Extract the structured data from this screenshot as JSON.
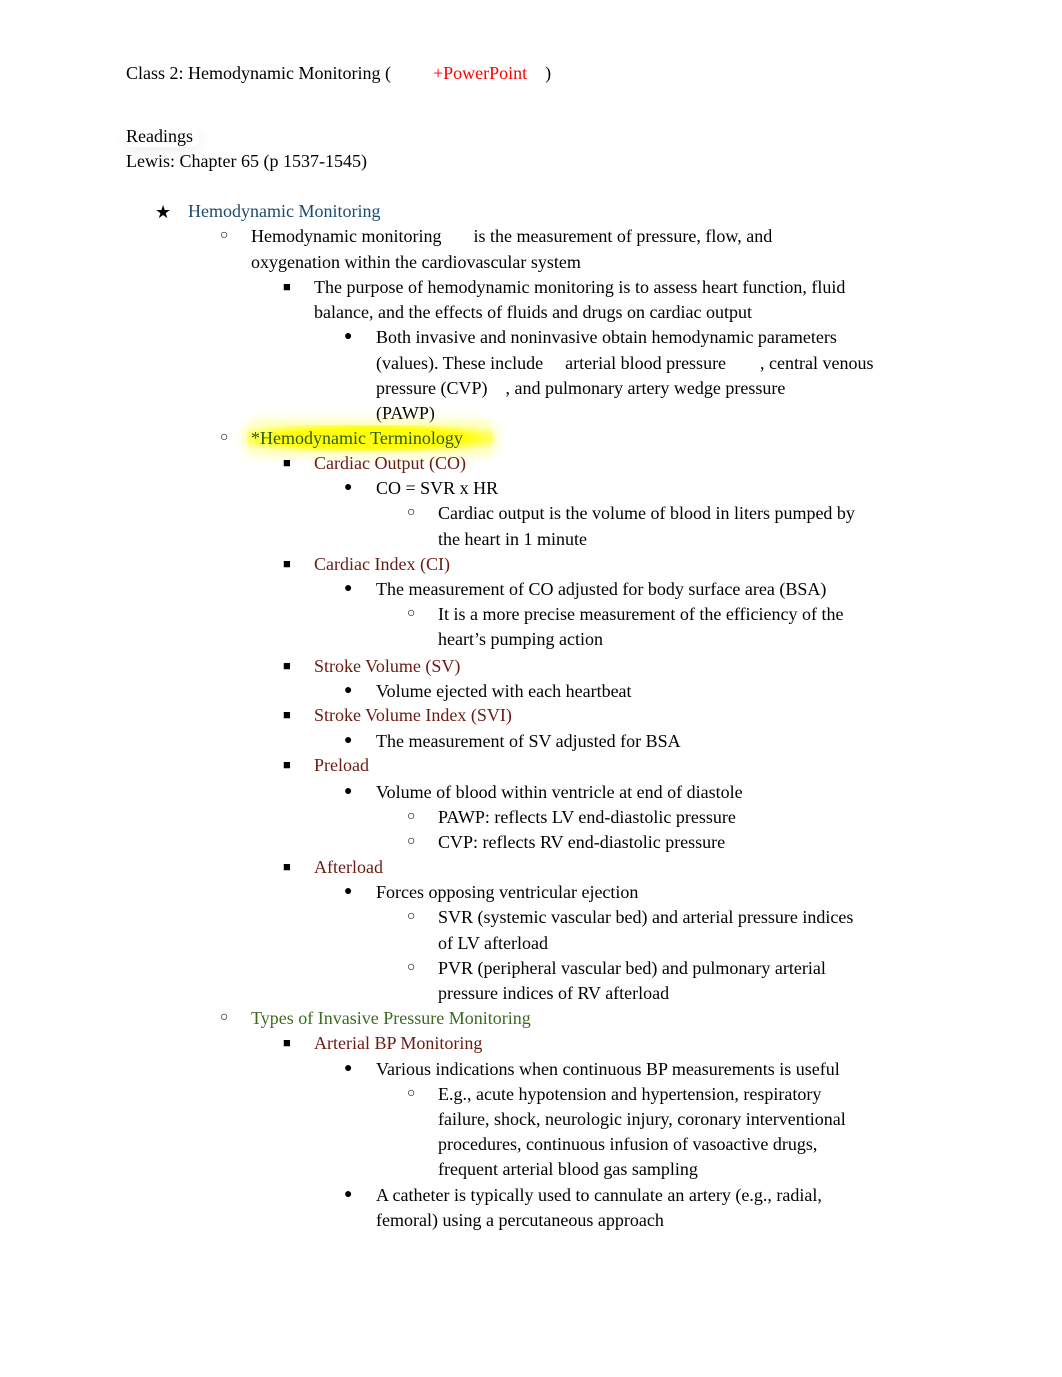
{
  "header": {
    "title_prefix": "Class 2: Hemodynamic Monitoring (",
    "title_link": "+PowerPoint",
    "title_suffix": ")"
  },
  "readings": {
    "label": "Readings",
    "reference": "Lewis: Chapter 65 (p 1537-1545)"
  },
  "outline": {
    "section_title": "Hemodynamic Monitoring",
    "definition": {
      "line1_a": "Hemodynamic monitoring",
      "line1_b": "is the measurement of pressure, flow, and",
      "line2": "oxygenation within the cardiovascular system"
    },
    "purpose": {
      "line1": "The purpose of hemodynamic monitoring is to assess heart function, fluid",
      "line2": "balance, and the effects of fluids and drugs on cardiac output"
    },
    "parameters": {
      "line1": "Both invasive and noninvasive obtain hemodynamic parameters",
      "line2_a": "(values). These include",
      "line2_b": "arterial blood pressure",
      "line2_c": ", central venous",
      "line3_a": "pressure (CVP)",
      "line3_b": ", and  pulmonary artery wedge pressure",
      "line4": "(PAWP)"
    },
    "terminology_title": "*Hemodynamic Terminology",
    "terms": {
      "co": {
        "title": "Cardiac Output (CO)",
        "formula": "CO = SVR x HR",
        "detail1": "Cardiac output is the volume of blood in liters pumped by",
        "detail2": "the heart in 1 minute"
      },
      "ci": {
        "title": "Cardiac Index (CI)",
        "def": "The measurement of CO adjusted for body surface area (BSA)",
        "detail1": "It is a more precise measurement of the efficiency of the",
        "detail2": "heart’s pumping action"
      },
      "sv": {
        "title": "Stroke Volume (SV)",
        "def": "Volume ejected with each heartbeat"
      },
      "svi": {
        "title": "Stroke Volume Index (SVI)",
        "def": "The measurement of SV adjusted for BSA"
      },
      "preload": {
        "title": "Preload",
        "def": "Volume of blood within ventricle at end of diastole",
        "detail1": "PAWP: reflects LV end-diastolic pressure",
        "detail2": "CVP: reflects RV end-diastolic pressure"
      },
      "afterload": {
        "title": "Afterload",
        "def": "Forces opposing ventricular ejection",
        "detail1a": "SVR (systemic vascular bed) and arterial pressure indices",
        "detail1b": "of LV afterload",
        "detail2a": "PVR (peripheral vascular bed) and pulmonary arterial",
        "detail2b": "pressure indices of RV afterload"
      }
    },
    "invasive_title": "Types of Invasive Pressure Monitoring",
    "arterial": {
      "title": "Arterial BP Monitoring",
      "indications": "Various indications when continuous BP measurements is useful",
      "examples1": "E.g., acute hypotension and hypertension, respiratory",
      "examples2": "failure, shock, neurologic injury, coronary interventional",
      "examples3": "procedures, continuous infusion of vasoactive drugs,",
      "examples4": "frequent arterial blood gas sampling",
      "catheter1": "A catheter is typically used to cannulate an artery (e.g., radial,",
      "catheter2": "femoral) using a percutaneous approach"
    }
  },
  "bullets": {
    "star": "★",
    "circle": "○",
    "square": "■",
    "dot": "●"
  }
}
